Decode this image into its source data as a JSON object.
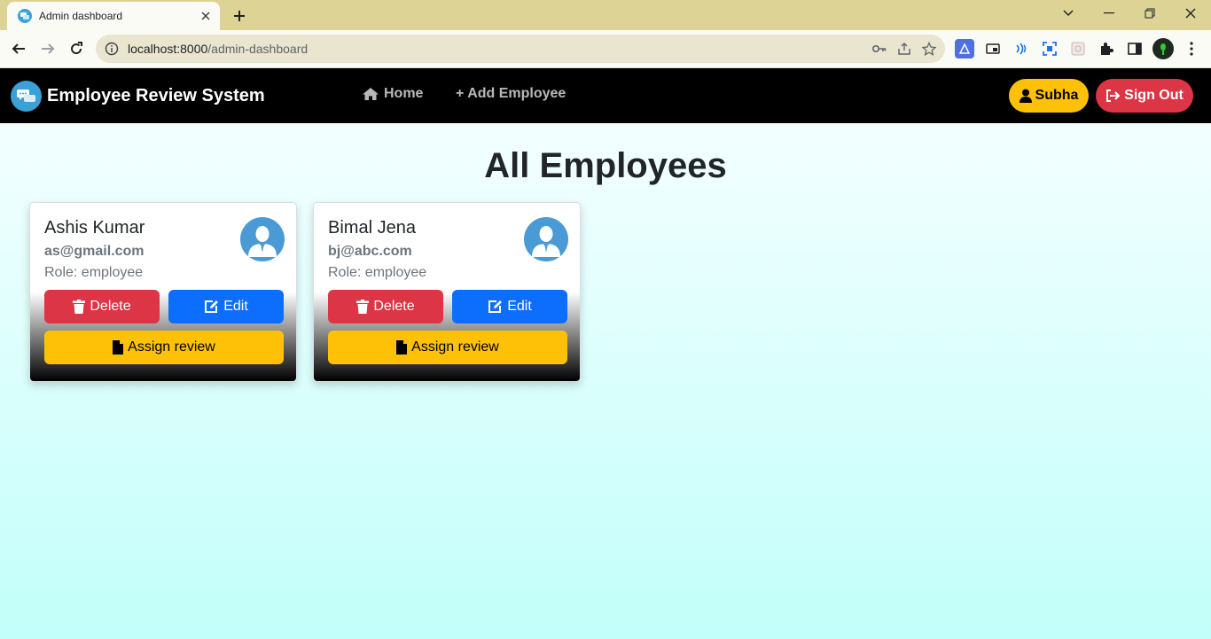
{
  "browser": {
    "tab_title": "Admin dashboard",
    "url_host": "localhost:8000",
    "url_path": "/admin-dashboard"
  },
  "navbar": {
    "brand": "Employee Review System",
    "links": [
      {
        "label": "Home",
        "icon": "house-icon"
      },
      {
        "label": "+ Add Employee",
        "icon": "plus-icon"
      }
    ],
    "user_label": "Subha",
    "signout_label": "Sign Out"
  },
  "main": {
    "title": "All Employees",
    "employees": [
      {
        "name": "Ashis Kumar",
        "email": "as@gmail.com",
        "role": "Role: employee"
      },
      {
        "name": "Bimal Jena",
        "email": "bj@abc.com",
        "role": "Role: employee"
      }
    ],
    "actions": {
      "delete_label": "Delete",
      "edit_label": "Edit",
      "assign_label": "Assign review"
    }
  },
  "colors": {
    "navbar_bg": "#000000",
    "warning": "#ffc107",
    "danger": "#dc3545",
    "primary": "#0d6efd",
    "page_bg_top": "#f3ffff",
    "page_bg_bottom": "#c2fffa"
  }
}
